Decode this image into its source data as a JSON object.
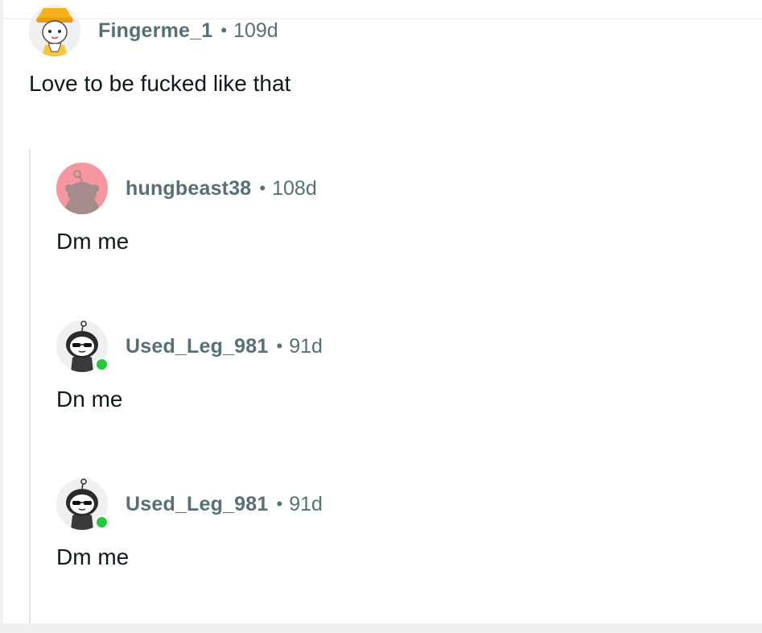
{
  "comments": [
    {
      "username": "Fingerme_1",
      "separator": "•",
      "age": "109d",
      "body": "Love to be fucked like that",
      "avatar": "yellow-hat-character-avatar"
    },
    {
      "username": "hungbeast38",
      "separator": "•",
      "age": "108d",
      "body": "Dm me",
      "avatar": "pink-default-snoo-avatar"
    },
    {
      "username": "Used_Leg_981",
      "separator": "•",
      "age": "91d",
      "body": "Dn me",
      "avatar": "sunglasses-snoo-avatar",
      "online": true
    },
    {
      "username": "Used_Leg_981",
      "separator": "•",
      "age": "91d",
      "body": "Dm me",
      "avatar": "sunglasses-snoo-avatar",
      "online": true
    }
  ],
  "colors": {
    "username": "#576f76",
    "body_text": "#0f1a1c",
    "online_indicator": "#28c73c",
    "thread_line": "#e2e5e8",
    "pink_avatar_bg": "#f497a1"
  }
}
